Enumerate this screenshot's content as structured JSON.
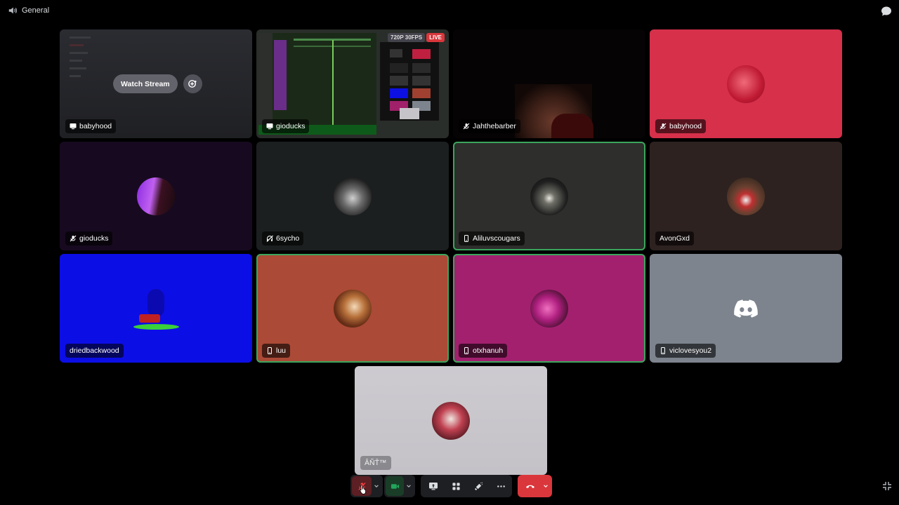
{
  "channel": {
    "name": "General",
    "icon": "speaker-icon"
  },
  "stream": {
    "watch_label": "Watch Stream",
    "quality": "720P 30FPS",
    "live": "LIVE"
  },
  "tiles": [
    {
      "name": "babyhood",
      "status_icon": "screen-share-icon",
      "background": "#2a2b30"
    },
    {
      "name": "gioducks",
      "status_icon": "screen-share-icon",
      "background": "#1a2a1a"
    },
    {
      "name": "Jahthebarber",
      "status_icon": "muted-mic-icon",
      "background": "#0a0505"
    },
    {
      "name": "babyhood",
      "status_icon": "muted-mic-icon",
      "background": "#d6304b"
    },
    {
      "name": "gioducks",
      "status_icon": "muted-mic-icon",
      "background": "#170a20"
    },
    {
      "name": "6sycho",
      "status_icon": "deafened-icon",
      "background": "#1c1f20"
    },
    {
      "name": "Aliluvscougars",
      "status_icon": "mobile-icon",
      "background": "#2e2f2c"
    },
    {
      "name": "AvonGxd",
      "status_icon": "",
      "background": "#2d2220"
    },
    {
      "name": "driedbackwood",
      "status_icon": "",
      "background": "#0c0ee6"
    },
    {
      "name": "luu",
      "status_icon": "mobile-icon",
      "background": "#ab4a36"
    },
    {
      "name": "otxhanuh",
      "status_icon": "mobile-icon",
      "background": "#a3206f"
    },
    {
      "name": "viclovesyou2",
      "status_icon": "mobile-icon",
      "background": "#7d848e"
    },
    {
      "name": "ÂÑŤ™",
      "status_icon": "",
      "background": "#c6c4c9"
    }
  ],
  "colors": {
    "speaking": "#3ba55d",
    "end_call": "#da373c",
    "camera_on": "#248046",
    "mic_muted": "#5c1f23"
  }
}
